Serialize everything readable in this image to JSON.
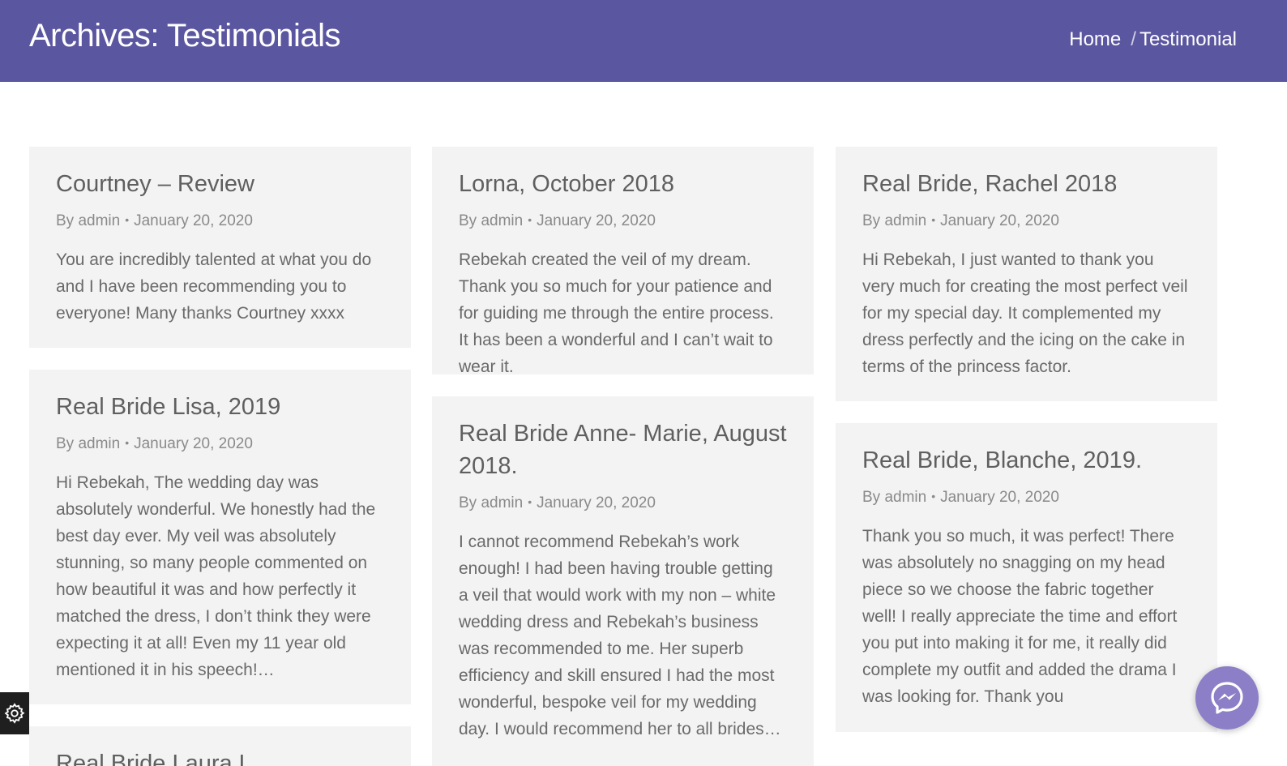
{
  "header": {
    "title": "Archives: Testimonials",
    "breadcrumb": {
      "home": "Home",
      "separator": "/",
      "current": "Testimonial"
    }
  },
  "posts": [
    {
      "title": "Courtney – Review",
      "author": "By admin",
      "date": "January 20, 2020",
      "excerpt": "You are incredibly talented at what you do and I have been recommending you to everyone! Many thanks Courtney xxxx"
    },
    {
      "title": "Lorna, October 2018",
      "author": "By admin",
      "date": "January 20, 2020",
      "excerpt": "Rebekah created the veil of my dream. Thank you so much for your patience and for guiding me through the entire process. It has been a wonderful and I can’t wait to wear it."
    },
    {
      "title": "Real Bride, Rachel 2018",
      "author": "By admin",
      "date": "January 20, 2020",
      "excerpt": "Hi Rebekah, I just wanted to thank you very much for creating the most perfect veil for my special day. It complemented my dress perfectly and the icing on the cake in terms of the princess factor."
    },
    {
      "title": "Real Bride Lisa, 2019",
      "author": "By admin",
      "date": "January 20, 2020",
      "excerpt": "Hi Rebekah,  The wedding day was absolutely wonderful. We honestly had the best day ever. My veil was absolutely stunning, so many people commented on how beautiful it was and how perfectly it matched the dress, I don’t think they were expecting it at all! Even my 11 year old mentioned it in his speech!…"
    },
    {
      "title": "Real Bride Anne- Marie, August 2018.",
      "author": "By admin",
      "date": "January 20, 2020",
      "excerpt": "I cannot recommend Rebekah’s work enough! I had been having trouble getting a veil that would work with my non – white wedding dress and Rebekah’s business was recommended to me.  Her superb efficiency and skill ensured I had the most wonderful, bespoke veil for my wedding day. I would recommend her to all brides…"
    },
    {
      "title": "Real Bride, Blanche, 2019.",
      "author": "By admin",
      "date": "January 20, 2020",
      "excerpt": "Thank you so much, it was perfect! There was absolutely no snagging on my head piece so we choose the fabric together well! I really appreciate the time and effort you put into making it for me, it really did complete my outfit and added the drama I was looking for.  Thank you"
    },
    {
      "title": "Real Bride Laura L...",
      "author": "",
      "date": "",
      "excerpt": ""
    }
  ],
  "icons": {
    "settings": "gear-icon",
    "chat": "messenger-icon"
  },
  "colors": {
    "header_bg": "#5b56a0",
    "card_bg": "#f3f3f3",
    "chat_bg": "#8c7fc7"
  }
}
